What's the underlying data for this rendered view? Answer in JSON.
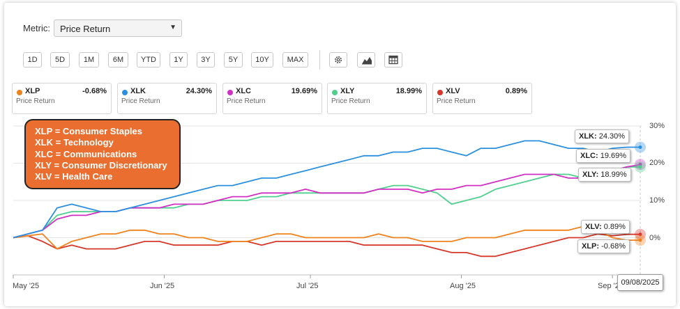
{
  "metric": {
    "label": "Metric:",
    "selected": "Price Return",
    "caret": "▼"
  },
  "ranges": [
    "1D",
    "5D",
    "1M",
    "6M",
    "YTD",
    "1Y",
    "3Y",
    "5Y",
    "10Y",
    "MAX"
  ],
  "tools": [
    "gear-icon",
    "mountain-chart-icon",
    "table-icon"
  ],
  "cards": [
    {
      "ticker": "XLP",
      "value": "-0.68%",
      "sub": "Price Return",
      "color": "#f0821e"
    },
    {
      "ticker": "XLK",
      "value": "24.30%",
      "sub": "Price Return",
      "color": "#2b8fe0"
    },
    {
      "ticker": "XLC",
      "value": "19.69%",
      "sub": "Price Return",
      "color": "#d12fc4"
    },
    {
      "ticker": "XLY",
      "value": "18.99%",
      "sub": "Price Return",
      "color": "#4fcf8d"
    },
    {
      "ticker": "XLV",
      "value": "0.89%",
      "sub": "Price Return",
      "color": "#d5372a"
    }
  ],
  "legend_note": [
    "XLP = Consumer Staples",
    "XLK = Technology",
    "XLC = Communications",
    "XLY = Consumer Discretionary",
    "XLV = Health Care"
  ],
  "end_labels": [
    {
      "ticker": "XLK:",
      "value": "24.30%"
    },
    {
      "ticker": "XLC:",
      "value": "19.69%"
    },
    {
      "ticker": "XLY:",
      "value": "18.99%"
    },
    {
      "ticker": "XLV:",
      "value": "0.89%"
    },
    {
      "ticker": "XLP:",
      "value": "-0.68%"
    }
  ],
  "crosshair_date": "09/08/2025",
  "chart_data": {
    "type": "line",
    "ylim": [
      -10,
      30
    ],
    "y_ticks": [
      30,
      20,
      10,
      0
    ],
    "y_tick_labels": [
      "30%",
      "20%",
      "10%",
      "0%"
    ],
    "x_ticks": [
      "May '25",
      "Jun '25",
      "Jul '25",
      "Aug '25",
      "Sep '25"
    ],
    "x_tick_days": [
      0,
      31,
      61,
      92,
      123
    ],
    "grid": true,
    "x_days": [
      0,
      3,
      6,
      9,
      12,
      15,
      18,
      21,
      24,
      27,
      30,
      33,
      36,
      39,
      42,
      45,
      48,
      51,
      54,
      57,
      60,
      63,
      66,
      69,
      72,
      75,
      78,
      81,
      84,
      87,
      90,
      93,
      96,
      99,
      102,
      105,
      108,
      111,
      114,
      117,
      120,
      123,
      126,
      129
    ],
    "series": [
      {
        "name": "XLK",
        "color": "#2b8fe0",
        "final": 24.3,
        "values": [
          0,
          1,
          2,
          8,
          9,
          8,
          7,
          7,
          8,
          9,
          10,
          11,
          12,
          13,
          14,
          14,
          15,
          16,
          16,
          17,
          18,
          19,
          20,
          21,
          22,
          22,
          23,
          23,
          24,
          24,
          23,
          22,
          24,
          24,
          25,
          26,
          26,
          25,
          24,
          24,
          23,
          24,
          24.3,
          24.3
        ]
      },
      {
        "name": "XLC",
        "color": "#d12fc4",
        "final": 19.69,
        "values": [
          0,
          1,
          2,
          5,
          6,
          6,
          7,
          7,
          8,
          8,
          8,
          9,
          9,
          9,
          10,
          11,
          11,
          12,
          12,
          12,
          13,
          12,
          12,
          12,
          12,
          13,
          13,
          13,
          12,
          13,
          13,
          14,
          14,
          15,
          16,
          17,
          17,
          17,
          16,
          16,
          17,
          18,
          19,
          19.69
        ]
      },
      {
        "name": "XLY",
        "color": "#4fcf8d",
        "final": 18.99,
        "values": [
          0,
          1,
          2,
          6,
          7,
          7,
          7,
          7,
          8,
          8,
          8,
          8,
          9,
          9,
          10,
          10,
          10,
          11,
          11,
          12,
          12,
          12,
          12,
          12,
          12,
          13,
          14,
          14,
          13,
          12,
          9,
          10,
          11,
          13,
          14,
          15,
          16,
          17,
          17,
          16,
          18,
          18,
          19,
          18.99
        ]
      },
      {
        "name": "XLV",
        "color": "#d5372a",
        "final": 0.89,
        "values": [
          0,
          0.5,
          -1,
          -3,
          -2,
          -3,
          -3,
          -3,
          -2,
          -1,
          -1,
          -2,
          -2,
          -2,
          -2,
          -1,
          -1,
          -2,
          -1,
          -1,
          -1,
          -1,
          -1,
          -1,
          -2,
          -2,
          -2,
          -2,
          -2,
          -3,
          -4,
          -4,
          -5,
          -5,
          -4,
          -3,
          -2,
          -1,
          0,
          0,
          1,
          0.5,
          0.89,
          0.89
        ]
      },
      {
        "name": "XLP",
        "color": "#f0821e",
        "final": -0.68,
        "values": [
          0,
          0.5,
          1,
          -3,
          -1,
          0,
          1,
          1,
          2,
          2,
          1,
          1,
          0,
          0,
          -1,
          -1,
          -1,
          0,
          1,
          1,
          0,
          0,
          0,
          0,
          0,
          1,
          0,
          0,
          -1,
          -1,
          -1,
          0,
          0,
          0,
          1,
          2,
          2,
          2,
          2,
          3,
          2,
          0,
          -0.68,
          -0.68
        ]
      }
    ]
  }
}
